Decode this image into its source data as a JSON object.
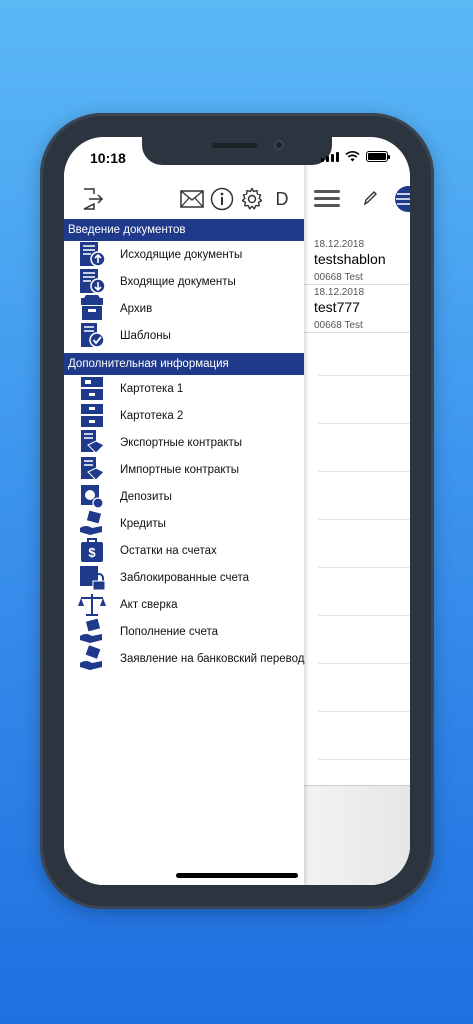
{
  "status": {
    "time": "10:18"
  },
  "toolbar": {
    "letter": "D"
  },
  "sections": [
    {
      "title": "Введение документов",
      "items": [
        {
          "label": "Исходящие документы",
          "icon": "outgoing-docs-icon"
        },
        {
          "label": "Входящие документы",
          "icon": "incoming-docs-icon"
        },
        {
          "label": "Архив",
          "icon": "archive-icon"
        },
        {
          "label": "Шаблоны",
          "icon": "templates-icon"
        }
      ]
    },
    {
      "title": "Дополнительная информация",
      "items": [
        {
          "label": "Картотека 1",
          "icon": "card-index-icon"
        },
        {
          "label": "Картотека 2",
          "icon": "card-index-icon"
        },
        {
          "label": "Экспортные контракты",
          "icon": "export-contracts-icon"
        },
        {
          "label": "Импортные контракты",
          "icon": "import-contracts-icon"
        },
        {
          "label": "Депозиты",
          "icon": "deposits-icon"
        },
        {
          "label": "Кредиты",
          "icon": "credits-icon"
        },
        {
          "label": "Остатки на счетах",
          "icon": "balance-icon"
        },
        {
          "label": "Заблокированные счета",
          "icon": "locked-account-icon"
        },
        {
          "label": "Акт сверка",
          "icon": "scales-icon"
        },
        {
          "label": "Пополнение счета",
          "icon": "top-up-icon"
        },
        {
          "label": "Заявление на банковский перевод",
          "icon": "transfer-icon"
        }
      ]
    }
  ],
  "list": [
    {
      "date": "18.12.2018",
      "title": "testshablon",
      "sub": "00668 Test"
    },
    {
      "date": "18.12.2018",
      "title": "test777",
      "sub": "00668 Test"
    }
  ],
  "colors": {
    "section_header": "#1f3a8a",
    "icon": "#1f3a8a"
  }
}
